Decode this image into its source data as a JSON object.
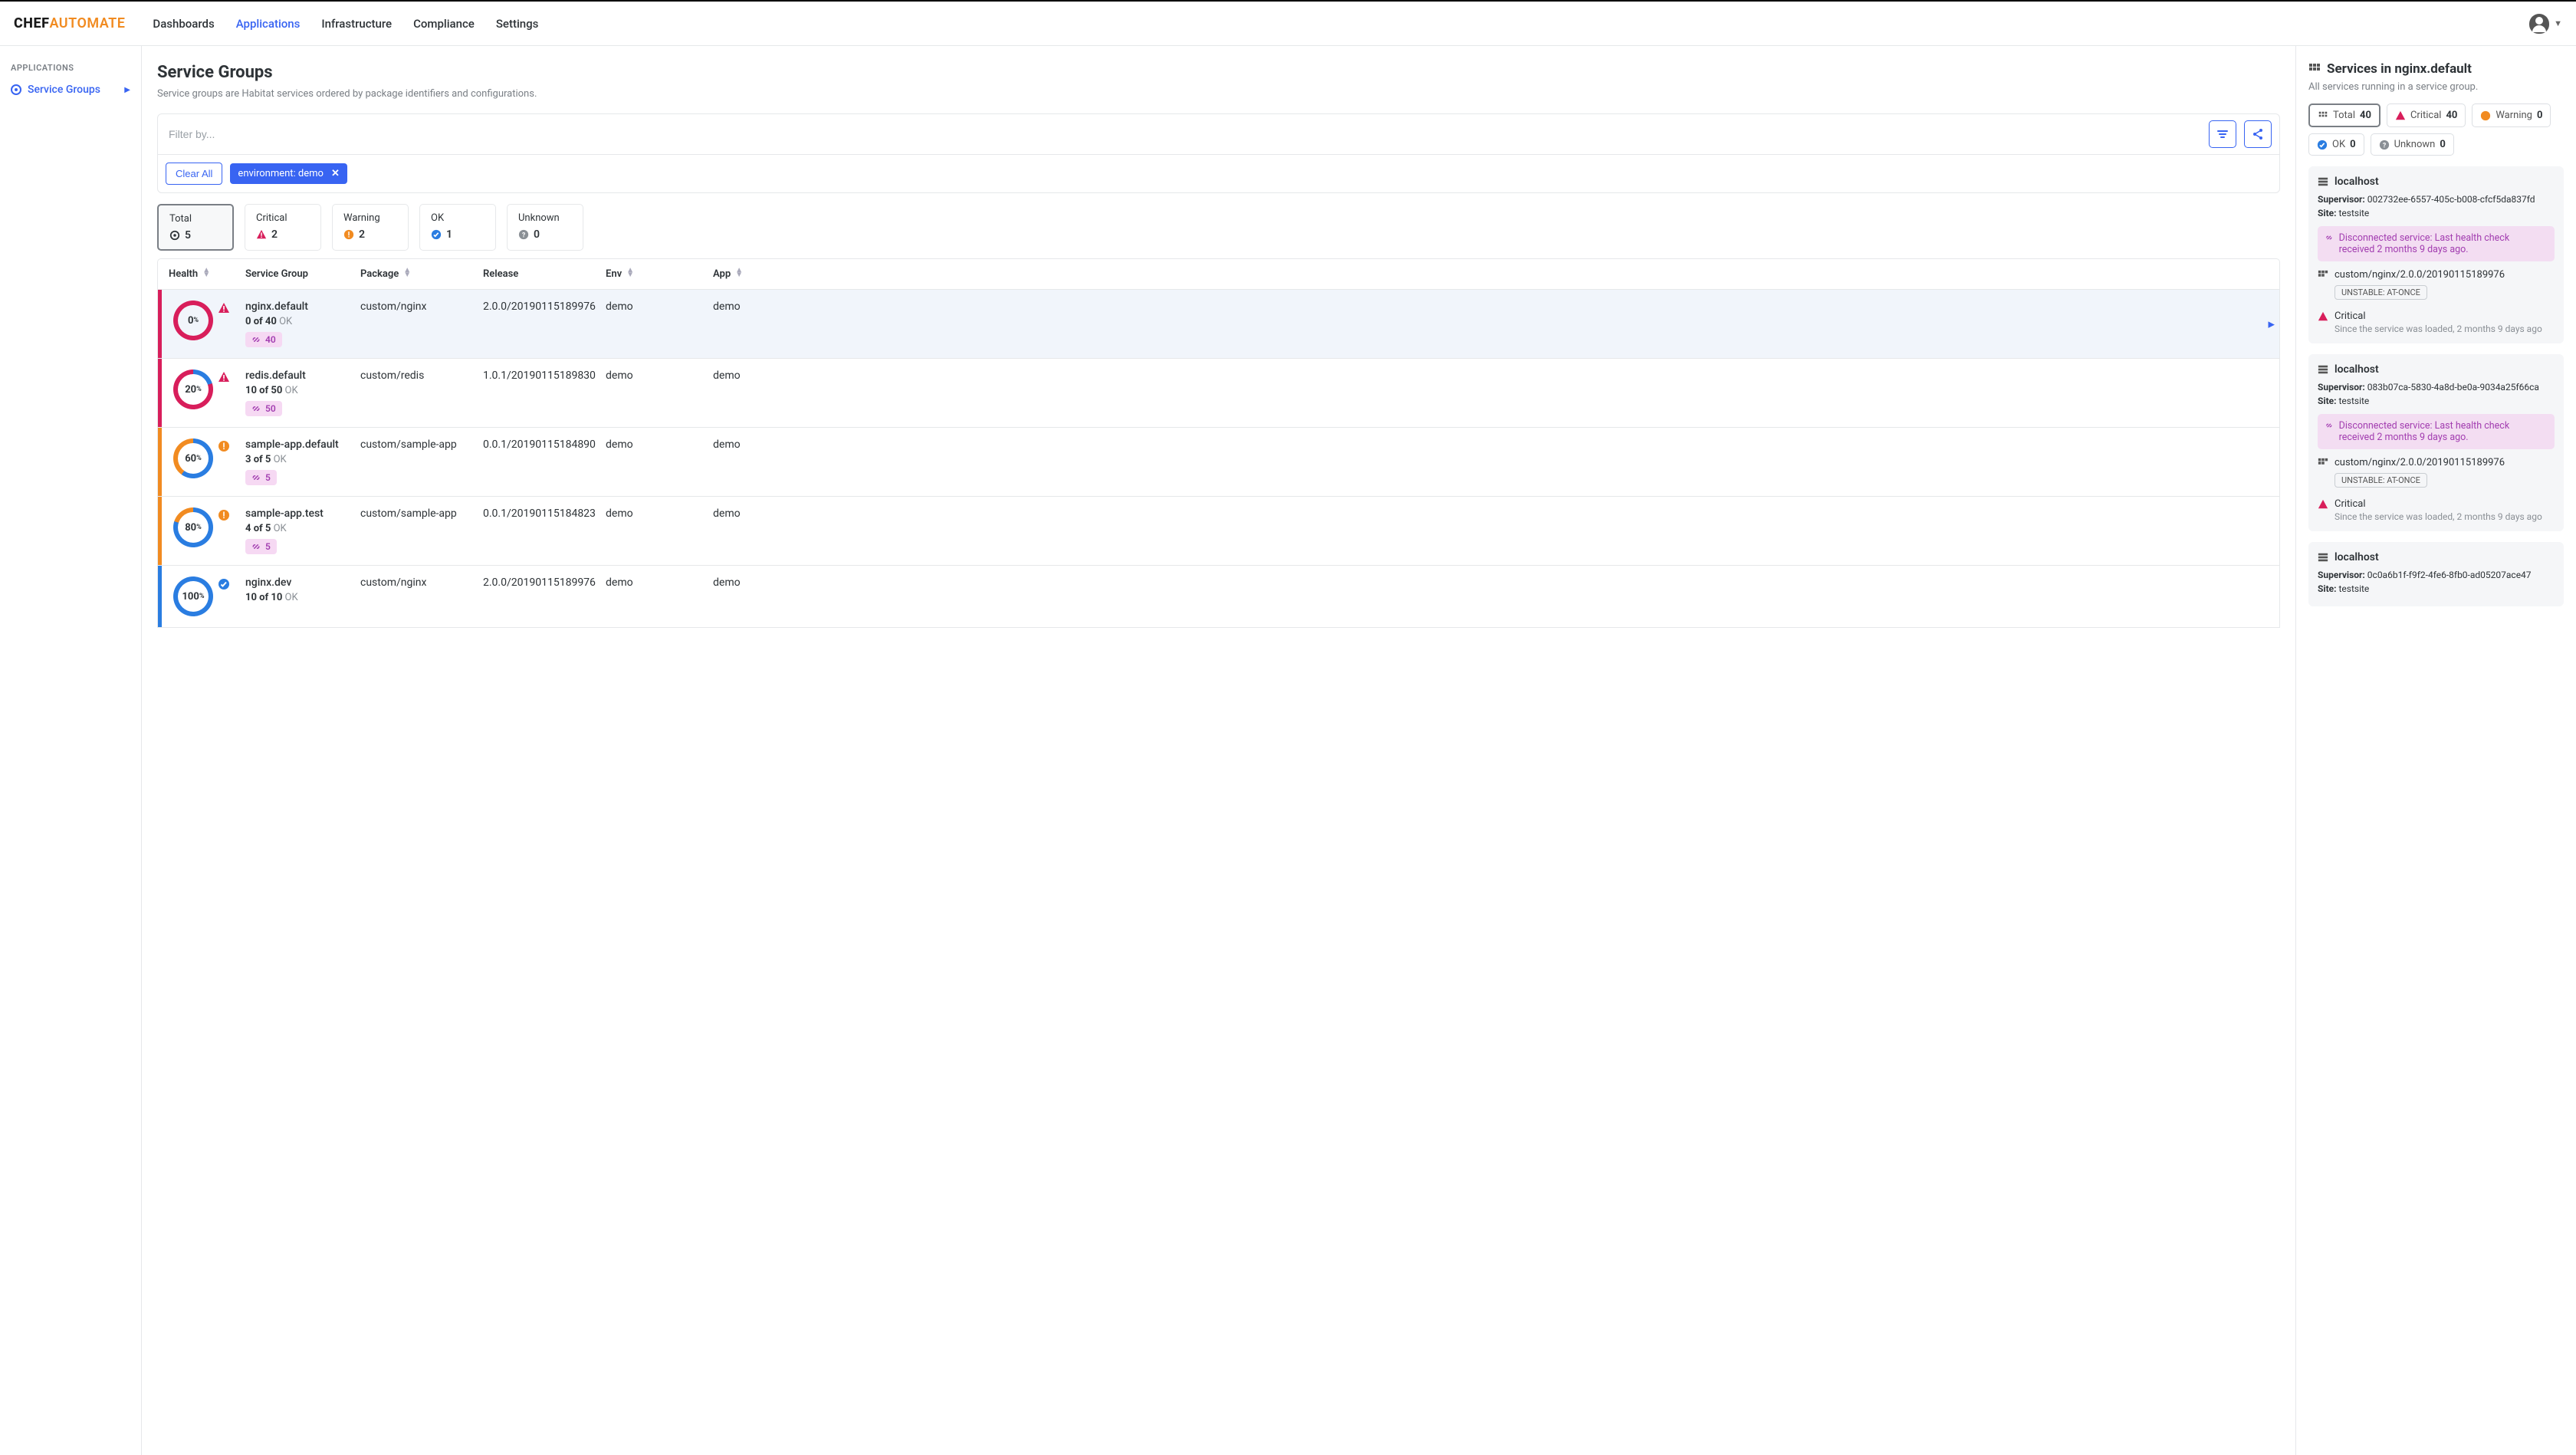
{
  "logo": {
    "chef": "CHEF",
    "auto": "AUTOMATE"
  },
  "nav": {
    "dashboards": "Dashboards",
    "applications": "Applications",
    "infrastructure": "Infrastructure",
    "compliance": "Compliance",
    "settings": "Settings"
  },
  "sidebar": {
    "section": "APPLICATIONS",
    "item": "Service Groups"
  },
  "main": {
    "title": "Service Groups",
    "subtitle": "Service groups are Habitat services ordered by package identifiers and configurations.",
    "filter_placeholder": "Filter by...",
    "clear_all": "Clear All",
    "filter_chip": "environment: demo"
  },
  "stats": {
    "total": {
      "label": "Total",
      "value": "5"
    },
    "critical": {
      "label": "Critical",
      "value": "2"
    },
    "warning": {
      "label": "Warning",
      "value": "2"
    },
    "ok": {
      "label": "OK",
      "value": "1"
    },
    "unknown": {
      "label": "Unknown",
      "value": "0"
    }
  },
  "columns": {
    "health": "Health",
    "service_group": "Service Group",
    "package": "Package",
    "release": "Release",
    "env": "Env",
    "app": "App"
  },
  "rows": [
    {
      "pct": "0",
      "name": "nginx.default",
      "ok_num": "0 of 40",
      "ok_txt": "OK",
      "badge": "40",
      "package": "custom/nginx",
      "release": "2.0.0/20190115189976",
      "env": "demo",
      "app": "demo",
      "accent": "#d81e5b",
      "status": "critical",
      "donut_bg": "conic-gradient(#d81e5b 0 360deg)",
      "selected": true,
      "chev": true
    },
    {
      "pct": "20",
      "name": "redis.default",
      "ok_num": "10 of 50",
      "ok_txt": "OK",
      "badge": "50",
      "package": "custom/redis",
      "release": "1.0.1/20190115189830",
      "env": "demo",
      "app": "demo",
      "accent": "#d81e5b",
      "status": "critical",
      "donut_bg": "conic-gradient(#2a7de1 0 72deg, #d81e5b 72deg 360deg)"
    },
    {
      "pct": "60",
      "name": "sample-app.default",
      "ok_num": "3 of 5",
      "ok_txt": "OK",
      "badge": "5",
      "package": "custom/sample-app",
      "release": "0.0.1/20190115184890",
      "env": "demo",
      "app": "demo",
      "accent": "#f18b21",
      "status": "warning",
      "donut_bg": "conic-gradient(#2a7de1 0 216deg, #f18b21 216deg 360deg)"
    },
    {
      "pct": "80",
      "name": "sample-app.test",
      "ok_num": "4 of 5",
      "ok_txt": "OK",
      "badge": "5",
      "package": "custom/sample-app",
      "release": "0.0.1/20190115184823",
      "env": "demo",
      "app": "demo",
      "accent": "#f18b21",
      "status": "warning",
      "donut_bg": "conic-gradient(#2a7de1 0 288deg, #f18b21 288deg 360deg)"
    },
    {
      "pct": "100",
      "name": "nginx.dev",
      "ok_num": "10 of 10",
      "ok_txt": "OK",
      "badge": "",
      "package": "custom/nginx",
      "release": "2.0.0/20190115189976",
      "env": "demo",
      "app": "demo",
      "accent": "#2a7de1",
      "status": "ok",
      "donut_bg": "conic-gradient(#2a7de1 0 360deg)"
    }
  ],
  "panel": {
    "title": "Services in nginx.default",
    "sub": "All services running in a service group.",
    "chips": {
      "total": {
        "label": "Total",
        "n": "40"
      },
      "critical": {
        "label": "Critical",
        "n": "40"
      },
      "warning": {
        "label": "Warning",
        "n": "0"
      },
      "ok": {
        "label": "OK",
        "n": "0"
      },
      "unknown": {
        "label": "Unknown",
        "n": "0"
      }
    },
    "services": [
      {
        "host": "localhost",
        "supervisor_k": "Supervisor:",
        "supervisor": "002732ee-6557-405c-b008-cfcf5da837fd",
        "site_k": "Site:",
        "site": "testsite",
        "disconnected": "Disconnected service: Last health check received 2 months 9 days ago.",
        "pkg": "custom/nginx/2.0.0/20190115189976",
        "tag": "UNSTABLE: AT-ONCE",
        "status": "Critical",
        "since": "Since the service was loaded, 2 months 9 days ago"
      },
      {
        "host": "localhost",
        "supervisor_k": "Supervisor:",
        "supervisor": "083b07ca-5830-4a8d-be0a-9034a25f66ca",
        "site_k": "Site:",
        "site": "testsite",
        "disconnected": "Disconnected service: Last health check received 2 months 9 days ago.",
        "pkg": "custom/nginx/2.0.0/20190115189976",
        "tag": "UNSTABLE: AT-ONCE",
        "status": "Critical",
        "since": "Since the service was loaded, 2 months 9 days ago"
      },
      {
        "host": "localhost",
        "supervisor_k": "Supervisor:",
        "supervisor": "0c0a6b1f-f9f2-4fe6-8fb0-ad05207ace47",
        "site_k": "Site:",
        "site": "testsite"
      }
    ]
  }
}
